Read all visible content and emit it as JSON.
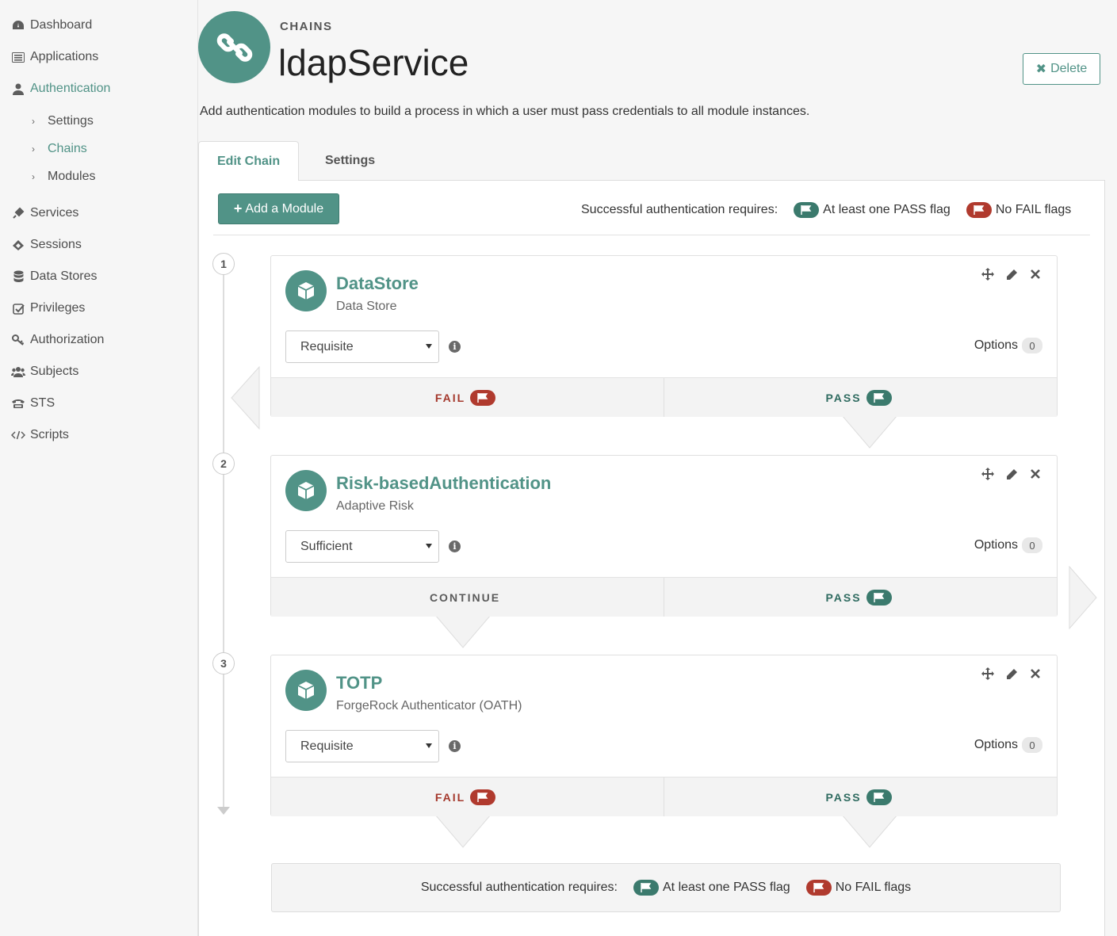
{
  "sidebar": {
    "items": [
      {
        "label": "Dashboard",
        "icon": "dashboard-icon"
      },
      {
        "label": "Applications",
        "icon": "list-icon"
      },
      {
        "label": "Authentication",
        "icon": "user-icon"
      },
      {
        "label": "Services",
        "icon": "plug-icon"
      },
      {
        "label": "Sessions",
        "icon": "ticket-icon"
      },
      {
        "label": "Data Stores",
        "icon": "database-icon"
      },
      {
        "label": "Privileges",
        "icon": "checkbox-icon"
      },
      {
        "label": "Authorization",
        "icon": "key-icon"
      },
      {
        "label": "Subjects",
        "icon": "users-icon"
      },
      {
        "label": "STS",
        "icon": "phone-icon"
      },
      {
        "label": "Scripts",
        "icon": "code-icon"
      }
    ],
    "auth_sub": [
      {
        "label": "Settings"
      },
      {
        "label": "Chains"
      },
      {
        "label": "Modules"
      }
    ]
  },
  "header": {
    "kicker": "CHAINS",
    "title": "ldapService",
    "delete_label": "Delete",
    "description": "Add authentication modules to build a process in which a user must pass credentials to all module instances."
  },
  "tabs": [
    {
      "label": "Edit Chain"
    },
    {
      "label": "Settings"
    }
  ],
  "toolbar": {
    "add_label": "Add a Module",
    "requires_label": "Successful authentication requires:",
    "pass_requirement": "At least one PASS flag",
    "fail_requirement": "No FAIL flags"
  },
  "modules": [
    {
      "step": "1",
      "name": "DataStore",
      "type": "Data Store",
      "criteria": "Requisite",
      "options_label": "Options",
      "options_count": "0",
      "left_outcome": "FAIL",
      "right_outcome": "PASS"
    },
    {
      "step": "2",
      "name": "Risk-basedAuthentication",
      "type": "Adaptive Risk",
      "criteria": "Sufficient",
      "options_label": "Options",
      "options_count": "0",
      "left_outcome": "CONTINUE",
      "right_outcome": "PASS"
    },
    {
      "step": "3",
      "name": "TOTP",
      "type": "ForgeRock Authenticator (OATH)",
      "criteria": "Requisite",
      "options_label": "Options",
      "options_count": "0",
      "left_outcome": "FAIL",
      "right_outcome": "PASS"
    }
  ],
  "footer": {
    "requires_label": "Successful authentication requires:",
    "pass_requirement": "At least one PASS flag",
    "fail_requirement": "No FAIL flags"
  },
  "colors": {
    "accent": "#519387",
    "pass": "#3b7a6d",
    "fail": "#b03a2e"
  }
}
